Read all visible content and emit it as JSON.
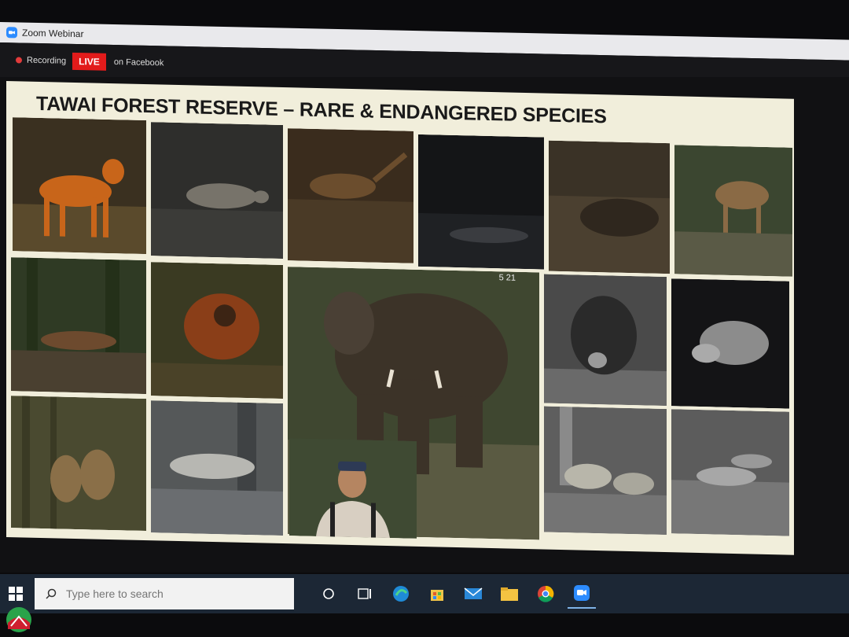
{
  "window": {
    "title": "Zoom Webinar"
  },
  "status": {
    "recording_label": "Recording",
    "live_label": "LIVE",
    "platform_label": "on Facebook"
  },
  "slide": {
    "title": "TAWAI FOREST RESERVE – RARE & ENDANGERED SPECIES",
    "camera_index": "5 21",
    "photos": [
      {
        "subject": "barking deer",
        "bg": "#5a4a2c",
        "fg": "#c8651a"
      },
      {
        "subject": "civet",
        "bg": "#3b3b38",
        "fg": "#77736a"
      },
      {
        "subject": "pheasant",
        "bg": "#4a3a26",
        "fg": "#6b4d2d"
      },
      {
        "subject": "dark night scene",
        "bg": "#1f2124",
        "fg": "#3a3c40"
      },
      {
        "subject": "deer in leaf litter",
        "bg": "#4b4030",
        "fg": "#3a2f24"
      },
      {
        "subject": "sambar deer",
        "bg": "#4c5a3e",
        "fg": "#8a6a45"
      },
      {
        "subject": "marten",
        "bg": "#3c4a30",
        "fg": "#6d4a2e"
      },
      {
        "subject": "orangutan",
        "bg": "#4a4228",
        "fg": "#8a3e18"
      },
      {
        "subject": "bornean elephant",
        "bg": "#5a6040",
        "fg": "#3c3328"
      },
      {
        "subject": "sun bear",
        "bg": "#6a6a6a",
        "fg": "#2a2a2a"
      },
      {
        "subject": "wild boar night",
        "bg": "#141416",
        "fg": "#aaaaaa"
      },
      {
        "subject": "pig-tailed macaques",
        "bg": "#4a4a30",
        "fg": "#8a6f48"
      },
      {
        "subject": "clouded leopard",
        "bg": "#6a6d70",
        "fg": "#b7b7b2"
      },
      {
        "subject": "pangolins",
        "bg": "#747474",
        "fg": "#b8b6aa"
      },
      {
        "subject": "otter civets",
        "bg": "#777777",
        "fg": "#a7a7a7"
      },
      {
        "subject": "researcher",
        "bg": "#3f4a33",
        "fg": "#d8cfc2"
      }
    ]
  },
  "taskbar": {
    "search_placeholder": "Type here to search",
    "icons": [
      "task-view-icon",
      "timeline-icon",
      "edge-icon",
      "store-icon",
      "mail-icon",
      "file-explorer-icon",
      "chrome-icon",
      "zoom-icon"
    ]
  }
}
